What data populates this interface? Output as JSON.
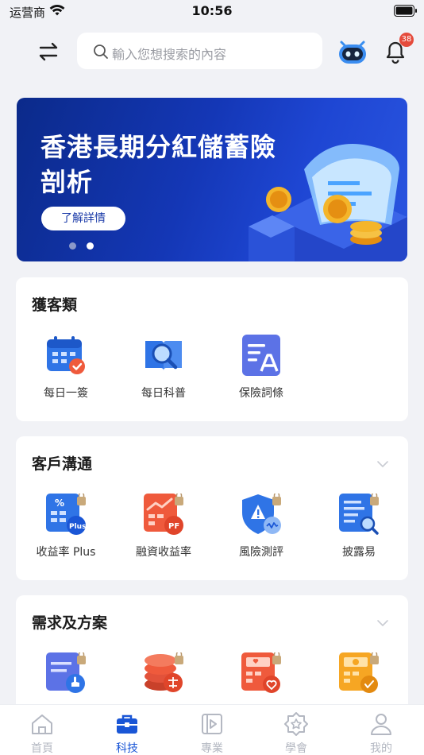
{
  "status_bar": {
    "carrier": "运营商",
    "time": "10:56"
  },
  "header": {
    "search_placeholder": "輸入您想搜索的內容",
    "notification_count": "38"
  },
  "banner": {
    "title": "香港長期分紅儲蓄險剖析",
    "cta": "了解詳情",
    "page_count": 2,
    "active_page": 2
  },
  "sections": [
    {
      "title": "獲客類",
      "collapsible": false,
      "items": [
        {
          "label": "每日一簽",
          "icon": "calendar-check-icon"
        },
        {
          "label": "每日科普",
          "icon": "book-magnifier-icon"
        },
        {
          "label": "保險詞條",
          "icon": "document-text-icon"
        }
      ]
    },
    {
      "title": "客戶溝通",
      "collapsible": true,
      "items": [
        {
          "label": "收益率 Plus",
          "icon": "percent-calculator-icon"
        },
        {
          "label": "融資收益率",
          "icon": "finance-chart-icon"
        },
        {
          "label": "風險測評",
          "icon": "risk-shield-icon"
        },
        {
          "label": "披露易",
          "icon": "disclosure-search-icon"
        }
      ]
    },
    {
      "title": "需求及方案",
      "collapsible": true,
      "items": [
        {
          "label": "",
          "icon": "plan-hand-icon"
        },
        {
          "label": "",
          "icon": "retirement-coins-icon"
        },
        {
          "label": "",
          "icon": "heart-calculator-icon"
        },
        {
          "label": "",
          "icon": "coin-calculator-icon"
        }
      ]
    }
  ],
  "tabbar": {
    "active": "科技",
    "items": [
      {
        "label": "首頁",
        "icon": "home-icon"
      },
      {
        "label": "科技",
        "icon": "toolbox-icon"
      },
      {
        "label": "專業",
        "icon": "video-play-icon"
      },
      {
        "label": "學會",
        "icon": "badge-star-icon"
      },
      {
        "label": "我的",
        "icon": "user-icon"
      }
    ]
  },
  "colors": {
    "accent": "#1a56d6",
    "tab_inactive": "#b4b8c2",
    "badge": "#e54b3c",
    "banner": "#1437b6"
  }
}
